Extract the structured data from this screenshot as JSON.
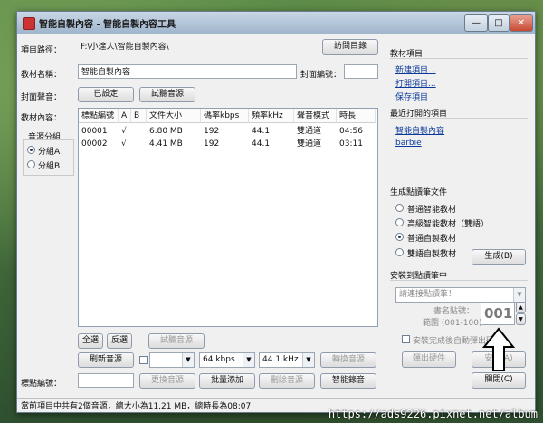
{
  "window": {
    "title": "智能自製內容 - 智能自製內容工具",
    "controls": {
      "minimize": "—",
      "maximize": "□",
      "close": "✕"
    }
  },
  "form": {
    "path_label": "項目路徑：",
    "path_value": "F:\\小達人\\智能自製內容\\",
    "browse_button": "訪問目錄",
    "material_name_label": "教材名稱：",
    "material_name_value": "智能自製內容",
    "cover_no_label": "封面編號：",
    "cover_no_value": "",
    "cover_sound_label": "封面聲音：",
    "cover_sound_set_button": "已設定",
    "cover_sound_test_button": "試聽音源",
    "content_label": "教材內容：",
    "group_label": "音源分組",
    "groupA": "分組A",
    "groupB": "分組B"
  },
  "table": {
    "headers": [
      "標點編號",
      "A",
      "B",
      "文件大小",
      "碼率kbps",
      "頻率kHz",
      "聲音模式",
      "時長"
    ],
    "rows": [
      [
        "00001",
        "√",
        "",
        "6.80 MB",
        "192",
        "44.1",
        "雙通道",
        "04:56"
      ],
      [
        "00002",
        "√",
        "",
        "4.41 MB",
        "192",
        "44.1",
        "雙通道",
        "03:11"
      ]
    ]
  },
  "bottom": {
    "select_all": "全選",
    "invert": "反選",
    "test_sound": "試聽音源",
    "refresh": "刷新音源",
    "bitrate": "64 kbps",
    "freq": "44.1 kHz",
    "convert": "轉換音源",
    "point_no_label": "標點編號：",
    "point_no_value": "",
    "change_source": "更換音源",
    "batch_add": "批量添加",
    "delete_source": "刪除音源",
    "smart_record": "智能錄音"
  },
  "right": {
    "material_project_label": "教材項目",
    "new_project": "新建項目...",
    "open_project": "打開項目...",
    "save_project": "保存項目",
    "recent_label": "最近打開的項目",
    "recent_items": [
      "智能自製內容",
      "barbie"
    ],
    "generate_label": "生成點讀筆文件",
    "options": [
      "普通智能教材",
      "高級智能教材（雙語）",
      "普通自製教材",
      "雙語自製教材"
    ],
    "selected_option": 2,
    "generate_button": "生成(B)",
    "install_label": "安裝到點讀筆中",
    "pen_select_placeholder": "請連接點讀筆！",
    "book_no_label": "書名貼號：",
    "range_label": "範圍 (001-100)",
    "book_no_value": "001",
    "auto_eject_label": "安裝完成後自動彈出硬件",
    "eject_button": "彈出硬件",
    "install_button": "安裝(A)",
    "close_button": "關閉(C)"
  },
  "status": {
    "text": "當前項目中共有2個音源，總大小為11.21 MB，總時長為08:07"
  },
  "watermark": "https://ads9226.pixnet.net/album"
}
